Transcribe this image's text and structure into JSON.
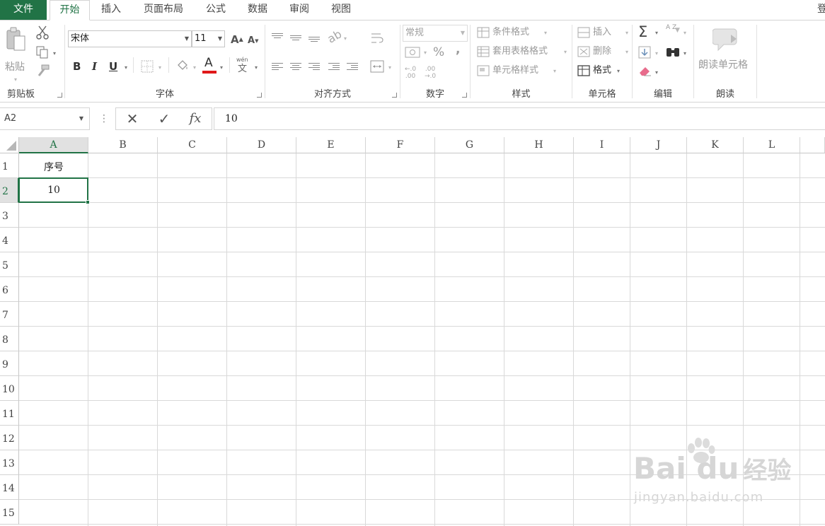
{
  "tabs": [
    "文件",
    "开始",
    "插入",
    "页面布局",
    "公式",
    "数据",
    "审阅",
    "视图"
  ],
  "tab_cut": "登",
  "accent": "#217346",
  "ribbon": {
    "clipboard": {
      "paste": "粘贴",
      "label": "剪贴板"
    },
    "font": {
      "name": "宋体",
      "size": "11",
      "bold": "B",
      "italic": "I",
      "underline": "U",
      "color_glyph": "A",
      "phonetic_top": "wén",
      "phonetic_char": "文",
      "grow": "A",
      "shrink": "A",
      "label": "字体"
    },
    "alignment": {
      "label": "对齐方式"
    },
    "number": {
      "format": "常规",
      "percent": "%",
      "comma": ",",
      "label": "数字"
    },
    "styles": {
      "conditional": "条件格式",
      "table": "套用表格格式",
      "cell_styles": "单元格样式",
      "label": "样式"
    },
    "cells": {
      "insert": "插入",
      "delete": "删除",
      "format": "格式",
      "label": "单元格"
    },
    "editing": {
      "sum": "Σ",
      "sort": "A Z",
      "label": "编辑"
    },
    "read": {
      "button": "朗读单元格",
      "label": "朗读"
    }
  },
  "formula_bar": {
    "name_box": "A2",
    "cancel": "✕",
    "enter": "✓",
    "fx": "fx",
    "value": "10"
  },
  "sheet": {
    "columns": [
      "A",
      "B",
      "C",
      "D",
      "E",
      "F",
      "G",
      "H",
      "I",
      "J",
      "K",
      "L"
    ],
    "rows": [
      "1",
      "2",
      "3",
      "4",
      "5",
      "6",
      "7",
      "8",
      "9",
      "10",
      "11",
      "12",
      "13",
      "14",
      "15"
    ],
    "selected_cell": "A2",
    "cells": {
      "A1": "序号",
      "A2": "10"
    }
  },
  "watermark": {
    "brand": "Bai du",
    "brand_cn": "经验",
    "url": "jingyan.baidu.com"
  }
}
